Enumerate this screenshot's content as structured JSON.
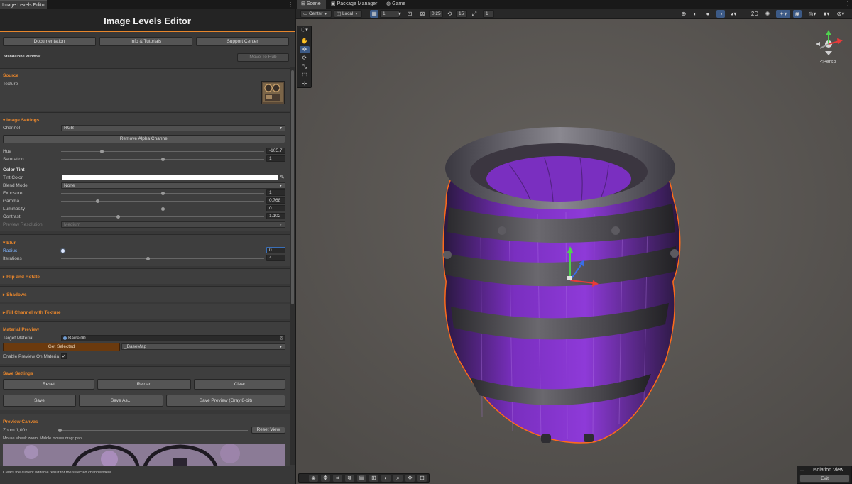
{
  "left_window": {
    "tab_label": "Image Levels Editor",
    "header_title": "Image Levels Editor",
    "links": {
      "documentation": "Documentation",
      "info": "Info & Tutorials",
      "support": "Support Center"
    },
    "standalone_label": "Standalone Window",
    "move_to_hub": "Move To Hub",
    "source": {
      "title": "Source",
      "texture_label": "Texture"
    },
    "image_settings": {
      "title": "Image Settings",
      "channel_label": "Channel",
      "channel_value": "RGB",
      "remove_alpha": "Remove Alpha Channel",
      "hue_label": "Hue",
      "hue_value": "-105.7",
      "hue_fraction": 0.2,
      "saturation_label": "Saturation",
      "saturation_value": "1",
      "saturation_fraction": 0.5,
      "color_tint_label": "Color Tint",
      "tint_color_label": "Tint Color",
      "tint_color": "#ffffff",
      "blend_mode_label": "Blend Mode",
      "blend_mode_value": "None",
      "exposure_label": "Exposure",
      "exposure_value": "1",
      "exposure_fraction": 0.5,
      "gamma_label": "Gamma",
      "gamma_value": "0.768",
      "gamma_fraction": 0.18,
      "luminosity_label": "Luminosity",
      "luminosity_value": "0",
      "luminosity_fraction": 0.5,
      "contrast_label": "Contrast",
      "contrast_value": "1.102",
      "contrast_fraction": 0.28,
      "preview_res_label": "Preview Resolution",
      "preview_res_value": "Medium"
    },
    "blur": {
      "title": "Blur",
      "radius_label": "Radius",
      "radius_value": "0",
      "radius_fraction": 0.0,
      "iterations_label": "Iterations",
      "iterations_value": "4",
      "iterations_fraction": 0.43
    },
    "collapsed_sections": {
      "flip_rotate": "Flip and Rotate",
      "shadows": "Shadows",
      "fill_channel": "Fill Channel with Texture"
    },
    "material_preview": {
      "title": "Material Preview",
      "target_label": "Target Material",
      "target_value": "Barrel00",
      "get_selected": "Get Selected",
      "map_value": "_BaseMap",
      "enable_label": "Enable Preview On Materia",
      "enable_checked": true
    },
    "save_settings": {
      "title": "Save Settings",
      "reset": "Reset",
      "reload": "Reload",
      "clear": "Clear",
      "save": "Save",
      "save_as": "Save As...",
      "save_preview": "Save Preview (Gray 8-bit)"
    },
    "preview_canvas": {
      "title": "Preview Canvas",
      "zoom_label": "Zoom 1,00x",
      "zoom_fraction": 0.0,
      "reset_view": "Reset View",
      "hint": "Mouse wheel: zoom. Middle mouse drag: pan."
    },
    "status_hint": "Clears the current editable result for the selected channel/view."
  },
  "scene_view": {
    "tabs": [
      "Scene",
      "Package Manager",
      "Game"
    ],
    "pivot_mode": "Center",
    "pivot_rotation": "Local",
    "grid_value": "1",
    "snap_value": "0.25",
    "angle_snap": "15",
    "scale_snap": "1",
    "persp_label": "<Persp",
    "isolation_title": "Isolation View",
    "exit_label": "Exit"
  },
  "colors": {
    "accent": "#e8862c",
    "selection_outline": "#ff6a1a",
    "barrel_purple": "#7a2fc0",
    "active_tool": "#3c5a86"
  }
}
